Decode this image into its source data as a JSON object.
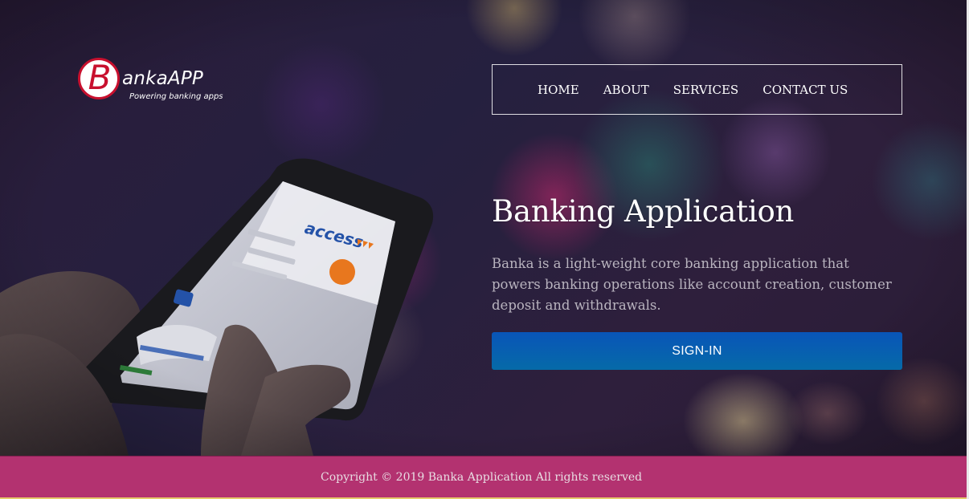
{
  "brand": {
    "logo_letter": "B",
    "name": "ankaAPP",
    "tagline": "Powering banking apps",
    "color": "#c8102e"
  },
  "nav": {
    "items": [
      {
        "label": "HOME"
      },
      {
        "label": "ABOUT"
      },
      {
        "label": "SERVICES"
      },
      {
        "label": "CONTACT US"
      }
    ]
  },
  "hero": {
    "title": "Banking Application",
    "description": "Banka is a light-weight core banking application that powers banking operations like account creation, customer deposit and withdrawals.",
    "signin_label": "SIGN-IN",
    "phone_screen_brand": "access",
    "phone_screen_brand_color": "#2452a8",
    "accent_orange": "#e8771e"
  },
  "footer": {
    "copyright": "Copyright © 2019 Banka Application All rights reserved",
    "background": "#b33270"
  }
}
